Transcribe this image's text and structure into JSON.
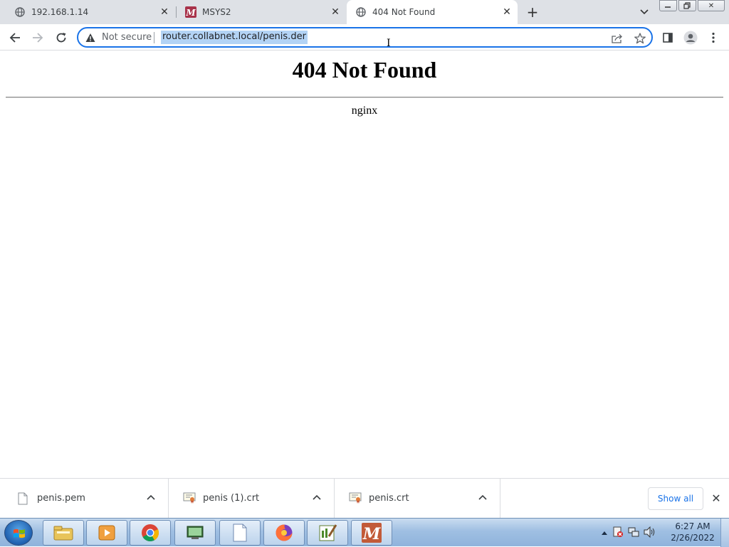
{
  "tabs": [
    {
      "title": "192.168.1.14",
      "icon": "globe-icon"
    },
    {
      "title": "MSYS2",
      "icon": "msys2-icon"
    },
    {
      "title": "404 Not Found",
      "icon": "globe-icon",
      "active": true
    }
  ],
  "toolbar": {
    "security_label": "Not secure",
    "url": "router.collabnet.local/penis.der"
  },
  "page": {
    "heading": "404 Not Found",
    "server": "nginx"
  },
  "downloads": [
    {
      "name": "penis.pem",
      "icon": "file-icon"
    },
    {
      "name": "penis (1).crt",
      "icon": "certificate-icon"
    },
    {
      "name": "penis.crt",
      "icon": "certificate-icon"
    }
  ],
  "shelf": {
    "show_all": "Show all"
  },
  "taskbar": {
    "time": "6:27 AM",
    "date": "2/26/2022"
  },
  "colors": {
    "accent": "#1a73e8",
    "tabstrip": "#dee1e6",
    "selection": "#b3d3f5"
  }
}
